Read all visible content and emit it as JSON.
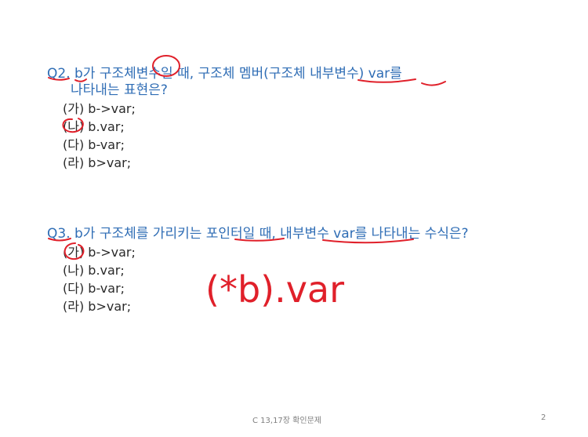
{
  "q2": {
    "line1": "Q2. b가 구조체변수일 때, 구조체 멤버(구조체 내부변수) var를",
    "line2": "나타내는 표현은?",
    "options": [
      "(가) b->var;",
      "(나) b.var;",
      "(다) b-var;",
      "(라) b>var;"
    ]
  },
  "q3": {
    "line1": "Q3. b가 구조체를 가리키는 포인터일 때, 내부변수 var를 나타내는 수식은?",
    "options": [
      "(가) b->var;",
      "(나) b.var;",
      "(다) b-var;",
      "(라) b>var;"
    ]
  },
  "annotation": {
    "handwritten_answer": "(*b).var",
    "ink_color": "#e0202a"
  },
  "footer": {
    "title": "C 13,17장 확인문제",
    "page": "2"
  }
}
